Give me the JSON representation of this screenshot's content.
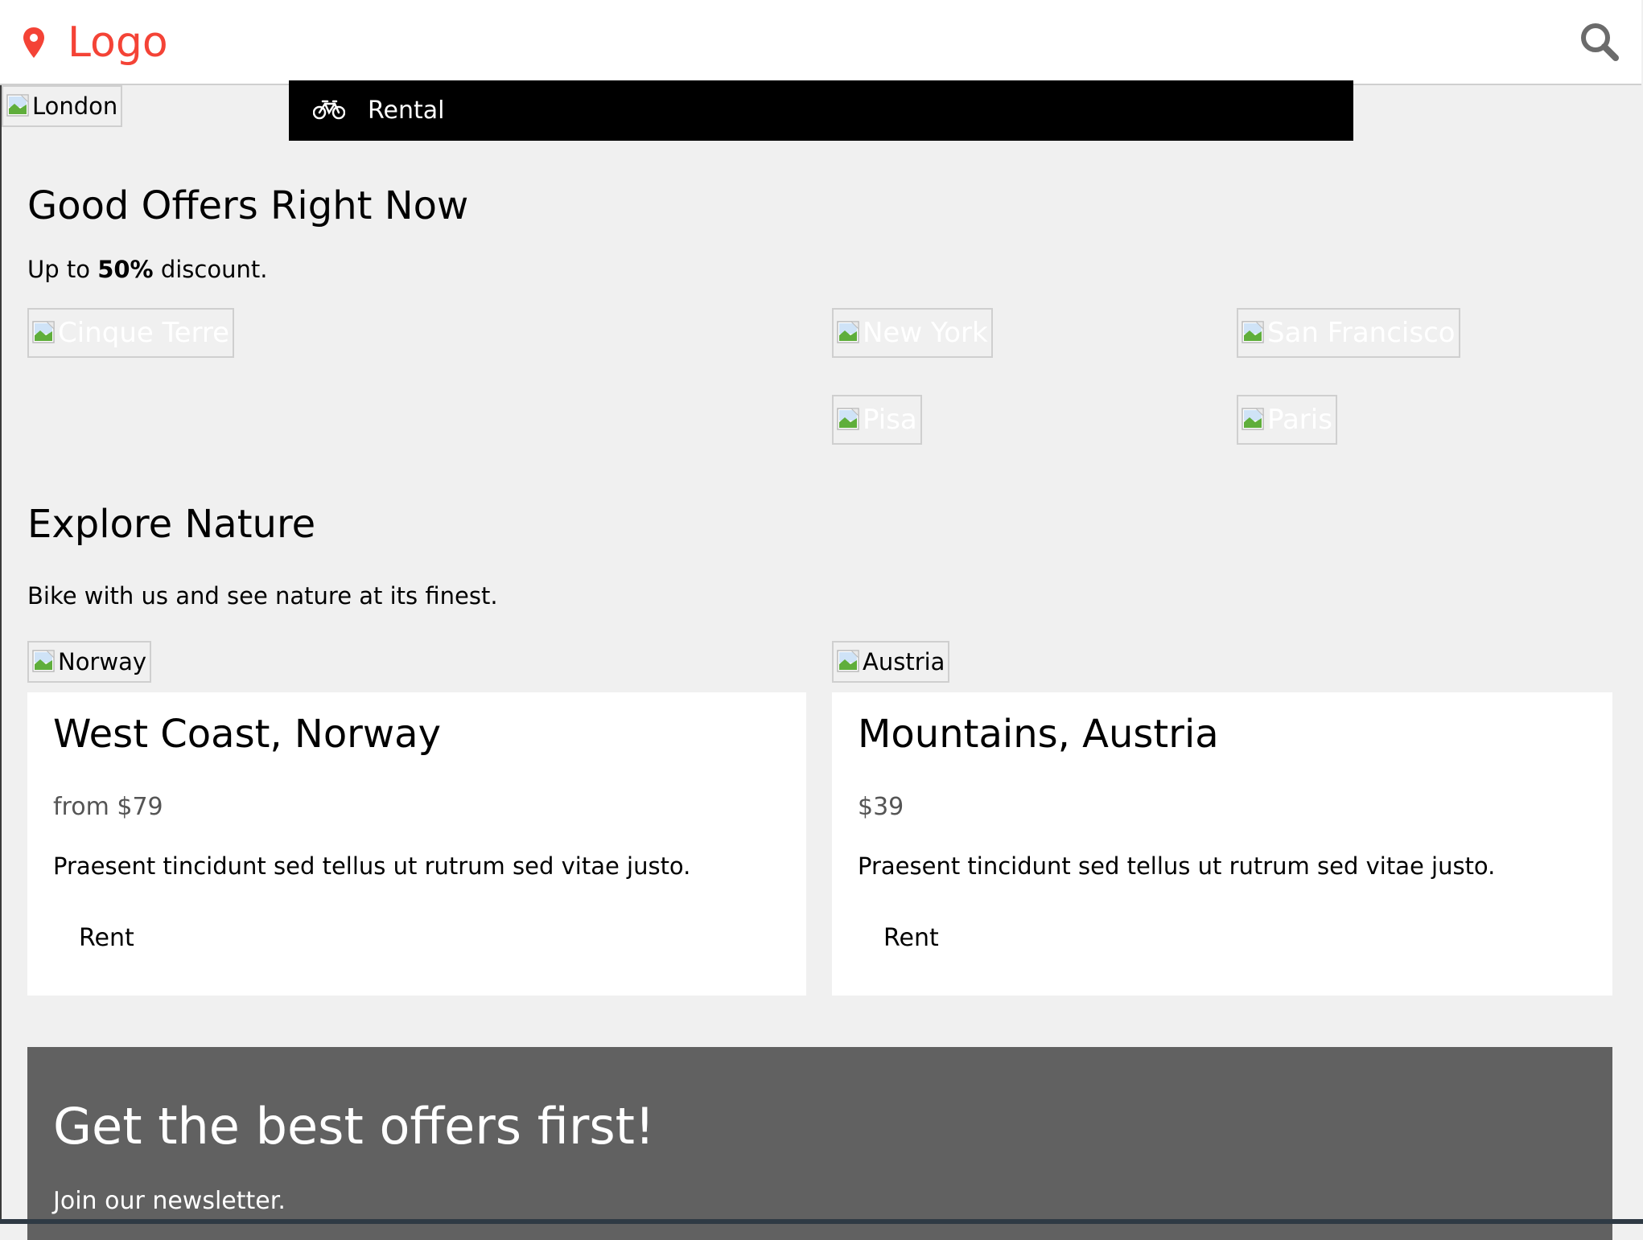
{
  "header": {
    "logo_text": "Logo",
    "accent": "#f44336"
  },
  "hero_image_alt": "London",
  "rental_bar": {
    "label": "Rental"
  },
  "offers": {
    "title": "Good Offers Right Now",
    "subtitle_prefix": "Up to ",
    "subtitle_bold": "50%",
    "subtitle_suffix": " discount.",
    "images": [
      "Cinque Terre",
      "New York",
      "San Francisco",
      "Pisa",
      "Paris"
    ]
  },
  "nature": {
    "title": "Explore Nature",
    "subtitle": "Bike with us and see nature at its finest.",
    "cards": [
      {
        "image_alt": "Norway",
        "title": "West Coast, Norway",
        "price": "from $79",
        "desc": "Praesent tincidunt sed tellus ut rutrum sed vitae justo.",
        "button": "Rent"
      },
      {
        "image_alt": "Austria",
        "title": "Mountains, Austria",
        "price": "$39",
        "desc": "Praesent tincidunt sed tellus ut rutrum sed vitae justo.",
        "button": "Rent"
      }
    ]
  },
  "newsletter": {
    "title": "Get the best offers first!",
    "subtitle": "Join our newsletter.",
    "bg": "#616161"
  },
  "icons": {
    "logo": "map-marker-icon",
    "search": "search-icon",
    "rental": "bicycle-icon",
    "broken_image": "broken-image-icon"
  }
}
